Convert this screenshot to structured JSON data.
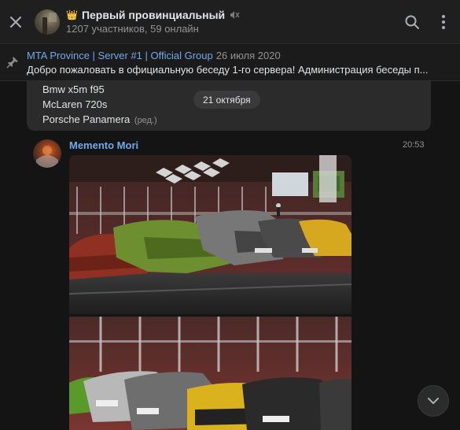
{
  "header": {
    "title": "Первый провинциальный",
    "crown_glyph": "👑",
    "subtitle": "1207 участников, 59 онлайн",
    "icons": [
      "close-icon",
      "mute-icon",
      "search-icon",
      "more-icon"
    ]
  },
  "pinned": {
    "author": "MTA Province | Server #1 | Official Group",
    "date": "26 июля 2020",
    "text": "Добро пожаловать в официальную беседу 1-го сервера! Администрация беседы п..."
  },
  "previous_message": {
    "cars": [
      "Bmw x5m f95",
      "McLaren 720s",
      "Porsche Panamera"
    ],
    "edited_mark": "(ред.)"
  },
  "date_divider": "21 октября",
  "message": {
    "author": "Memento Mori",
    "time": "20:53",
    "attachments": [
      "photo",
      "photo"
    ]
  },
  "colors": {
    "background": "#141414",
    "header": "#1f1f1f",
    "bubble": "#2b2b2b",
    "link": "#71aaeb",
    "muted": "#939393",
    "text": "#e1e3e6"
  }
}
